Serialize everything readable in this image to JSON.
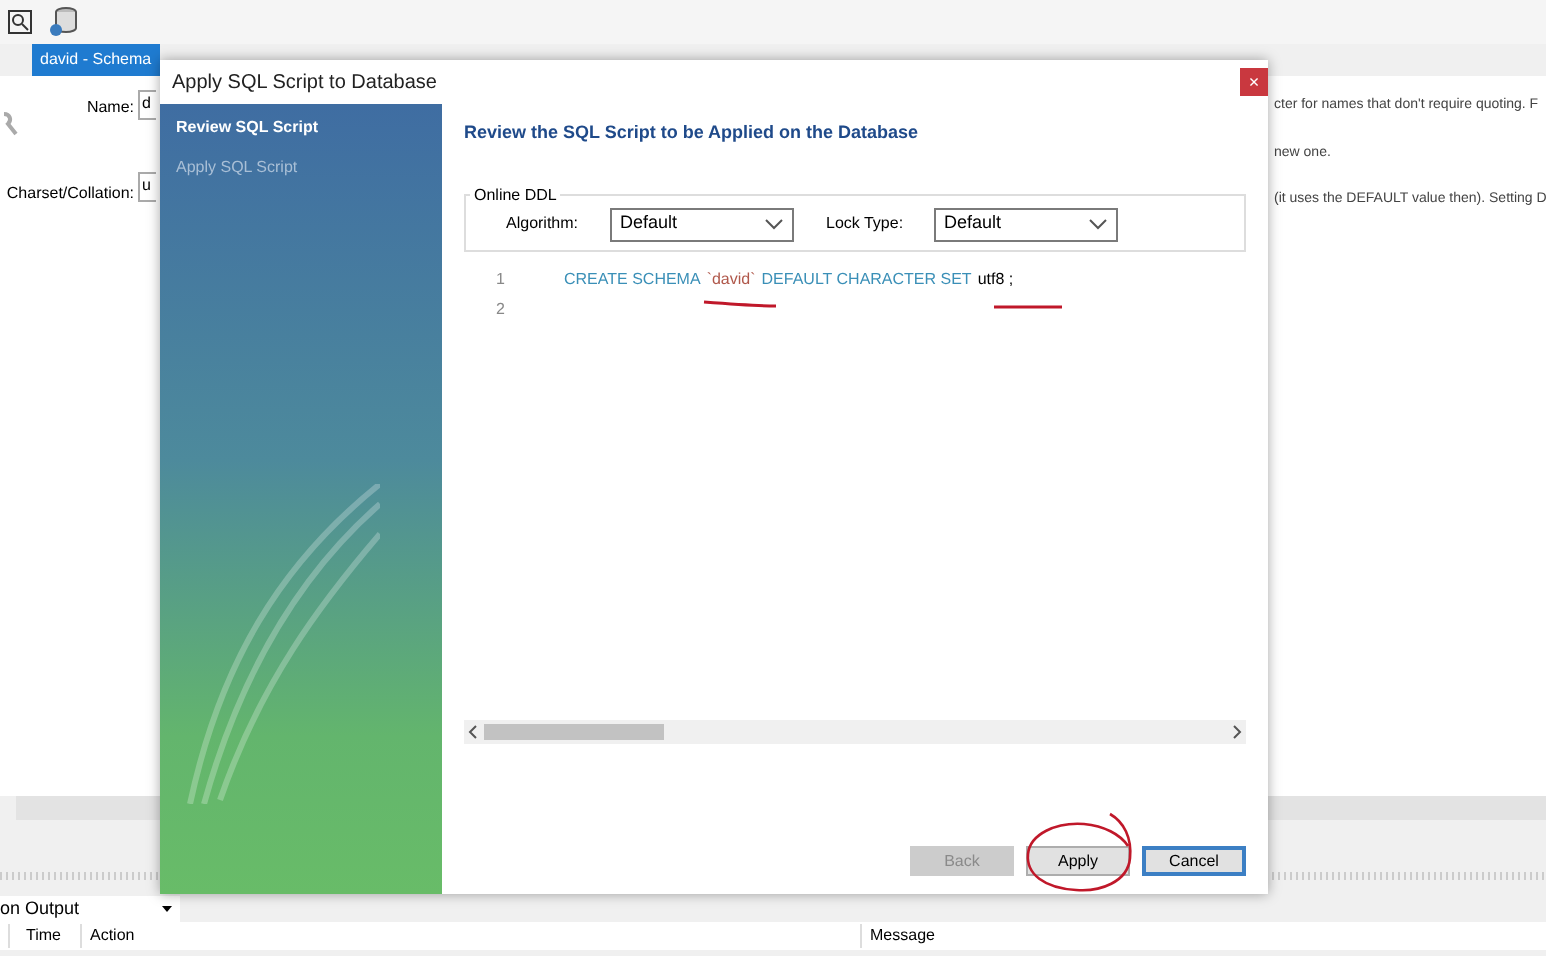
{
  "background": {
    "tab": "david - Schema",
    "name_label": "Name:",
    "name_value": "d",
    "charset_label": "Charset/Collation:",
    "charset_value": "u",
    "hints": [
      "cter for names that don't require quoting. F",
      "new one.",
      "(it uses the DEFAULT value then). Setting D"
    ],
    "output_selector": "on Output",
    "output_columns": [
      "Time",
      "Action",
      "Message"
    ]
  },
  "dialog": {
    "title": "Apply SQL Script to Database",
    "close": "×",
    "steps": [
      {
        "label": "Review SQL Script",
        "selected": true
      },
      {
        "label": "Apply SQL Script",
        "selected": false
      }
    ],
    "heading": "Review the SQL Script to be Applied on the Database",
    "group_title": "Online DDL",
    "algorithm": {
      "label": "Algorithm:",
      "value": "Default"
    },
    "lock_type": {
      "label": "Lock Type:",
      "value": "Default"
    },
    "lines": [
      {
        "number": "1",
        "tokens": [
          {
            "kind": "keyword",
            "text": "CREATE SCHEMA"
          },
          {
            "kind": "identifier",
            "text": "`david`"
          },
          {
            "kind": "keyword",
            "text": "DEFAULT CHARACTER SET"
          },
          {
            "kind": "plain",
            "text": "utf8 ;"
          }
        ]
      },
      {
        "number": "2"
      }
    ],
    "buttons": [
      {
        "label": "Back",
        "disabled": true,
        "default": false
      },
      {
        "label": "Apply",
        "disabled": false,
        "default": false
      },
      {
        "label": "Cancel",
        "disabled": false,
        "default": true
      }
    ]
  }
}
